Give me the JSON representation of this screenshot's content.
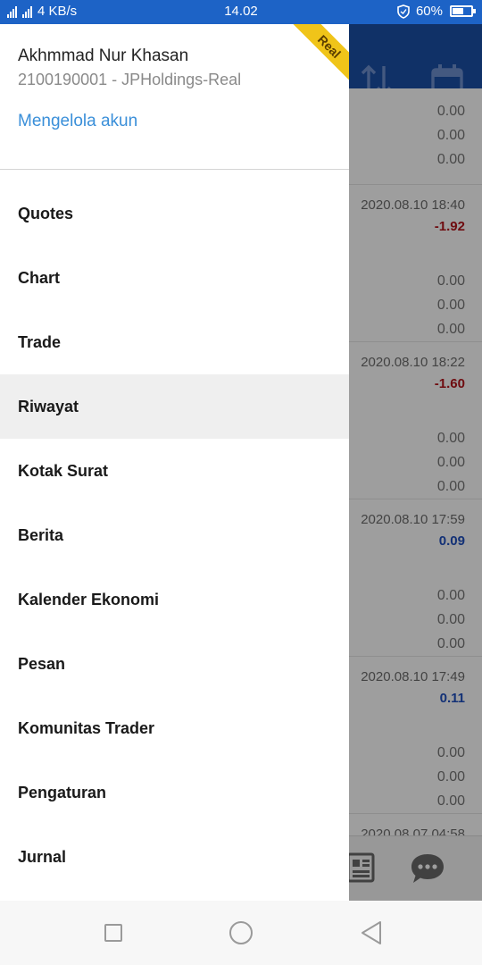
{
  "status_bar": {
    "network_speed": "4 KB/s",
    "time": "14.02",
    "battery": "60%",
    "battery_level": 0.6,
    "icons": [
      "signal-4g-icon",
      "signal-icon",
      "shield-icon",
      "battery-icon"
    ]
  },
  "app": {
    "header_icons": [
      "sort-icon",
      "calendar-icon"
    ],
    "top_values": [
      "0.00",
      "0.00",
      "0.00"
    ],
    "history": [
      {
        "date": "2020.08.10 18:40",
        "profit": "-1.92",
        "profit_color": "#b3141b",
        "values": [
          "0.00",
          "0.00",
          "0.00"
        ]
      },
      {
        "date": "2020.08.10 18:22",
        "profit": "-1.60",
        "profit_color": "#b3141b",
        "values": [
          "0.00",
          "0.00",
          "0.00"
        ]
      },
      {
        "date": "2020.08.10 17:59",
        "profit": "0.09",
        "profit_color": "#1f4fbf",
        "values": [
          "0.00",
          "0.00",
          "0.00"
        ]
      },
      {
        "date": "2020.08.10 17:49",
        "profit": "0.11",
        "profit_color": "#1f4fbf",
        "values": [
          "0.00",
          "0.00",
          "0.00"
        ]
      }
    ],
    "partial_date": "2020.08.07 04:58",
    "bottom_icons": [
      "news-icon",
      "chat-icon"
    ]
  },
  "drawer": {
    "account_name": "Akhmmad Nur Khasan",
    "account_id": "2100190001 - JPHoldings-Real",
    "manage_link": "Mengelola akun",
    "badge": "Real",
    "menu": [
      {
        "label": "Quotes"
      },
      {
        "label": "Chart"
      },
      {
        "label": "Trade"
      },
      {
        "label": "Riwayat",
        "active": true
      },
      {
        "label": "Kotak Surat"
      },
      {
        "label": "Berita"
      },
      {
        "label": "Kalender Ekonomi"
      },
      {
        "label": "Pesan"
      },
      {
        "label": "Komunitas Trader"
      },
      {
        "label": "Pengaturan"
      },
      {
        "label": "Jurnal"
      }
    ]
  },
  "nav_bar": {
    "icons": [
      "recent-apps-icon",
      "home-icon",
      "back-icon"
    ]
  }
}
